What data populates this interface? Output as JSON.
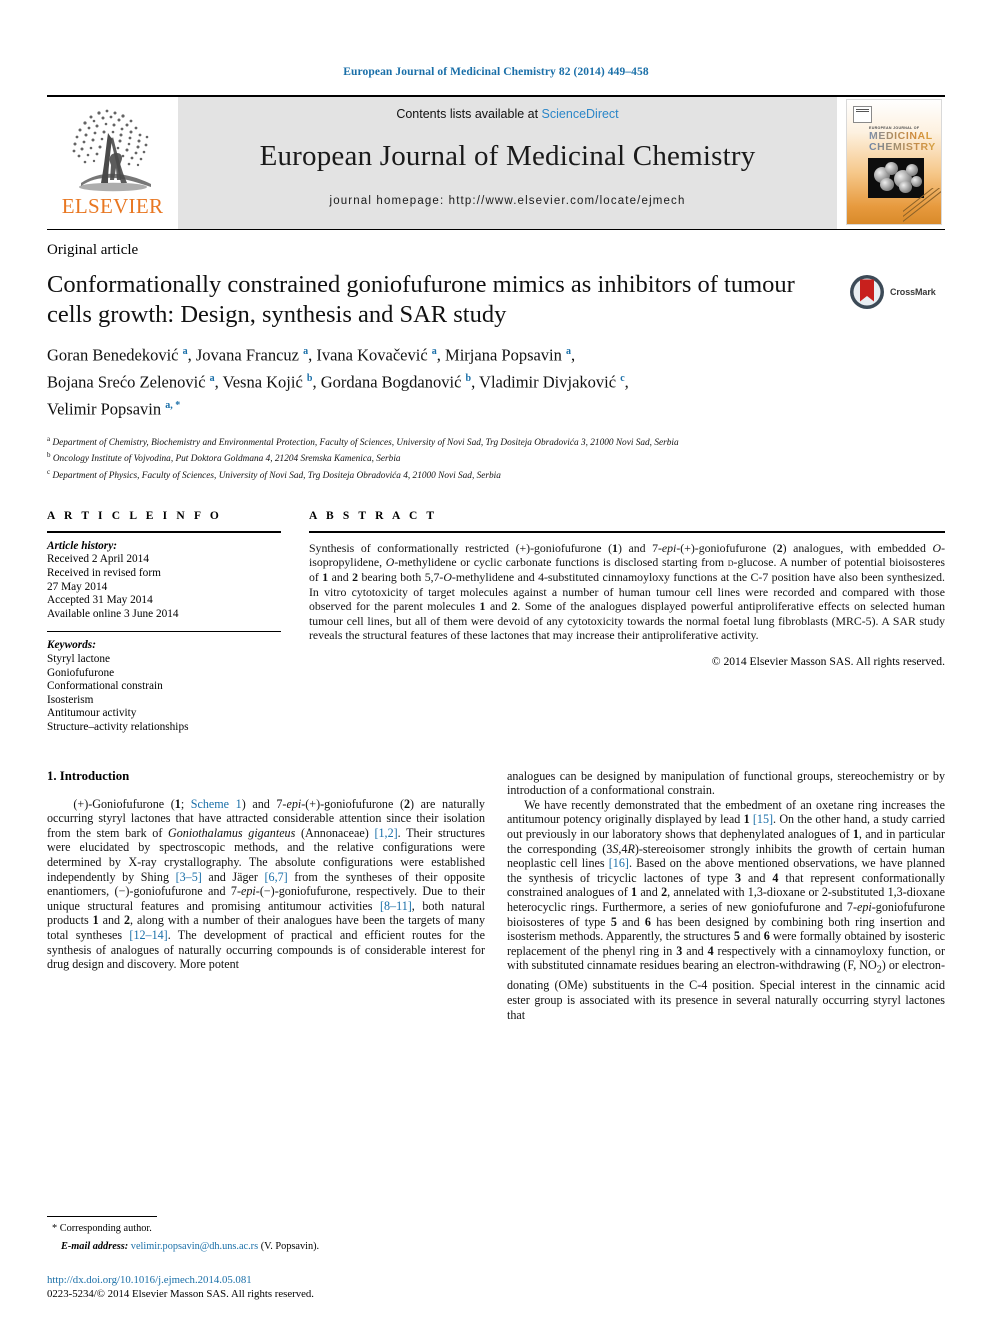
{
  "running_head": "European Journal of Medicinal Chemistry 82 (2014) 449–458",
  "masthead": {
    "publisher": "ELSEVIER",
    "contents_prefix": "Contents lists available at ",
    "contents_link": "ScienceDirect",
    "journal_title": "European Journal of Medicinal Chemistry",
    "homepage": "journal homepage: http://www.elsevier.com/locate/ejmech",
    "cover": {
      "line_small": "EUROPEAN JOURNAL OF",
      "line1": "MEDICINAL",
      "line2": "CHEMISTRY"
    }
  },
  "article": {
    "type": "Original article",
    "title": "Conformationally constrained goniofufurone mimics as inhibitors of tumour cells growth: Design, synthesis and SAR study",
    "crossmark_label": "CrossMark",
    "authors_lines": [
      "Goran Benedeković a, Jovana Francuz a, Ivana Kovačević a, Mirjana Popsavin a,",
      "Bojana Srećo Zelenović a, Vesna Kojić b, Gordana Bogdanović b, Vladimir Divjaković c,",
      "Velimir Popsavin a,*"
    ],
    "affiliations": [
      {
        "mark": "a",
        "text": "Department of Chemistry, Biochemistry and Environmental Protection, Faculty of Sciences, University of Novi Sad, Trg Dositeja Obradovića 3, 21000 Novi Sad, Serbia"
      },
      {
        "mark": "b",
        "text": "Oncology Institute of Vojvodina, Put Doktora Goldmana 4, 21204 Sremska Kamenica, Serbia"
      },
      {
        "mark": "c",
        "text": "Department of Physics, Faculty of Sciences, University of Novi Sad, Trg Dositeja Obradovića 4, 21000 Novi Sad, Serbia"
      }
    ]
  },
  "info": {
    "heading": "A R T I C L E   I N F O",
    "history_label": "Article history:",
    "history": [
      "Received 2 April 2014",
      "Received in revised form",
      "27 May 2014",
      "Accepted 31 May 2014",
      "Available online 3 June 2014"
    ],
    "keywords_label": "Keywords:",
    "keywords": [
      "Styryl lactone",
      "Goniofufurone",
      "Conformational constrain",
      "Isosterism",
      "Antitumour activity",
      "Structure–activity relationships"
    ]
  },
  "abstract": {
    "heading": "A B S T R A C T",
    "text": "Synthesis of conformationally restricted (+)-goniofufurone (1) and 7-epi-(+)-goniofufurone (2) analogues, with embedded O-isopropylidene, O-methylidene or cyclic carbonate functions is disclosed starting from D-glucose. A number of potential bioisosteres of 1 and 2 bearing both 5,7-O-methylidene and 4-substituted cinnamoyloxy functions at the C-7 position have also been synthesized. In vitro cytotoxicity of target molecules against a number of human tumour cell lines were recorded and compared with those observed for the parent molecules 1 and 2. Some of the analogues displayed powerful antiproliferative effects on selected human tumour cell lines, but all of them were devoid of any cytotoxicity towards the normal foetal lung fibroblasts (MRC-5). A SAR study reveals the structural features of these lactones that may increase their antiproliferative activity.",
    "copyright": "© 2014 Elsevier Masson SAS. All rights reserved."
  },
  "body": {
    "section_heading": "1.  Introduction",
    "left_paragraph": "(+)-Goniofufurone (1; Scheme 1) and 7-epi-(+)-goniofufurone (2) are naturally occurring styryl lactones that have attracted considerable attention since their isolation from the stem bark of Goniothalamus giganteus (Annonaceae) [1,2]. Their structures were elucidated by spectroscopic methods, and the relative configurations were determined by X-ray crystallography. The absolute configurations were established independently by Shing [3–5] and Jäger [6,7] from the syntheses of their opposite enantiomers, (−)-goniofufurone and 7-epi-(−)-goniofufurone, respectively. Due to their unique structural features and promising antitumour activities [8–11], both natural products 1 and 2, along with a number of their analogues have been the targets of many total syntheses [12–14]. The development of practical and efficient routes for the synthesis of analogues of naturally occurring compounds is of considerable interest for drug design and discovery. More potent",
    "right_paragraph_1": "analogues can be designed by manipulation of functional groups, stereochemistry or by introduction of a conformational constrain.",
    "right_paragraph_2": "We have recently demonstrated that the embedment of an oxetane ring increases the antitumour potency originally displayed by lead 1 [15]. On the other hand, a study carried out previously in our laboratory shows that dephenylated analogues of 1, and in particular the corresponding (3S,4R)-stereoisomer strongly inhibits the growth of certain human neoplastic cell lines [16]. Based on the above mentioned observations, we have planned the synthesis of tricyclic lactones of type 3 and 4 that represent conformationally constrained analogues of 1 and 2, annelated with 1,3-dioxane or 2-substituted 1,3-dioxane heterocyclic rings. Furthermore, a series of new goniofufurone and 7-epi-goniofufurone bioisosteres of type 5 and 6 has been designed by combining both ring insertion and isosterism methods. Apparently, the structures 5 and 6 were formally obtained by isosteric replacement of the phenyl ring in 3 and 4 respectively with a cinnamoyloxy function, or with substituted cinnamate residues bearing an electron-withdrawing (F, NO2) or electron-donating (OMe) substituents in the C-4 position. Special interest in the cinnamic acid ester group is associated with its presence in several naturally occurring styryl lactones that"
  },
  "footnote": {
    "star": "*",
    "corresponding": "Corresponding author.",
    "email_label": "E-mail address:",
    "email": "velimir.popsavin@dh.uns.ac.rs",
    "email_owner": "(V. Popsavin).",
    "doi": "http://dx.doi.org/10.1016/j.ejmech.2014.05.081",
    "issn_line": "0223-5234/© 2014 Elsevier Masson SAS. All rights reserved."
  },
  "colors": {
    "link_blue": "#1a6fa8",
    "sciencedirect_blue": "#2a86c8",
    "elsevier_orange": "#e87722",
    "band_gray": "#e3e3e3",
    "crossmark_red": "#c8201d"
  }
}
